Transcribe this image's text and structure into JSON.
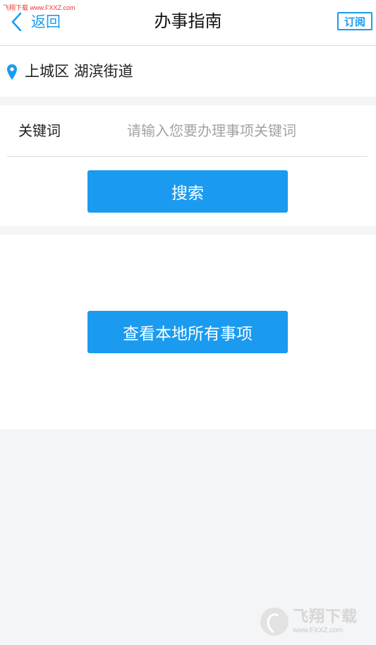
{
  "watermark": {
    "top_text": "飞翔下载 www.FXXZ.com",
    "bottom_main": "飞翔下载",
    "bottom_url": "www.FXXZ.com"
  },
  "header": {
    "back_label": "返回",
    "title": "办事指南",
    "subscribe_label": "订阅"
  },
  "location": {
    "text": "上城区 湖滨街道"
  },
  "search": {
    "label": "关键词",
    "value": "",
    "placeholder": "请输入您要办理事项关键词",
    "button_label": "搜索"
  },
  "list": {
    "view_all_label": "查看本地所有事项"
  },
  "colors": {
    "accent": "#1a9bf0",
    "background": "#f4f5f6",
    "placeholder": "#a3a3a3"
  },
  "icons": {
    "back": "chevron-left-icon",
    "location": "location-pin-icon"
  }
}
